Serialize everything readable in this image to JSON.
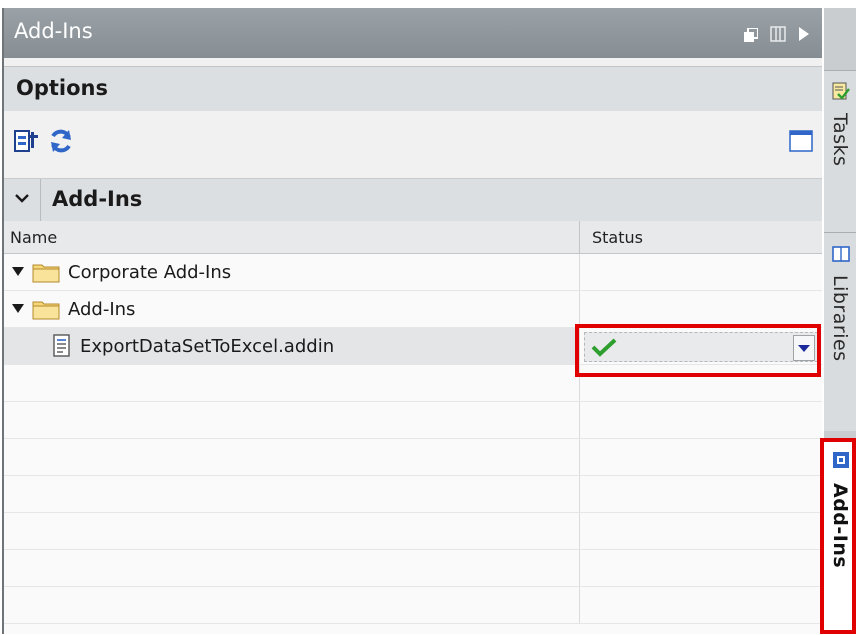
{
  "window": {
    "title": "Add-Ins"
  },
  "options": {
    "label": "Options"
  },
  "section": {
    "label": "Add-Ins"
  },
  "table": {
    "columns": {
      "name": "Name",
      "status": "Status"
    },
    "rows": [
      {
        "label": "Corporate Add-Ins",
        "type": "folder",
        "expanded": true
      },
      {
        "label": "Add-Ins",
        "type": "folder",
        "expanded": true
      },
      {
        "label": "ExportDataSetToExcel.addin",
        "type": "file",
        "status": "check-icon"
      }
    ]
  },
  "sidebar_tabs": [
    {
      "label": "Tasks",
      "active": false
    },
    {
      "label": "Libraries",
      "active": false
    },
    {
      "label": "Add-Ins",
      "active": true
    }
  ],
  "colors": {
    "highlight": "#e00000",
    "check": "#2e9e2e",
    "folder": "#f6d77a"
  }
}
